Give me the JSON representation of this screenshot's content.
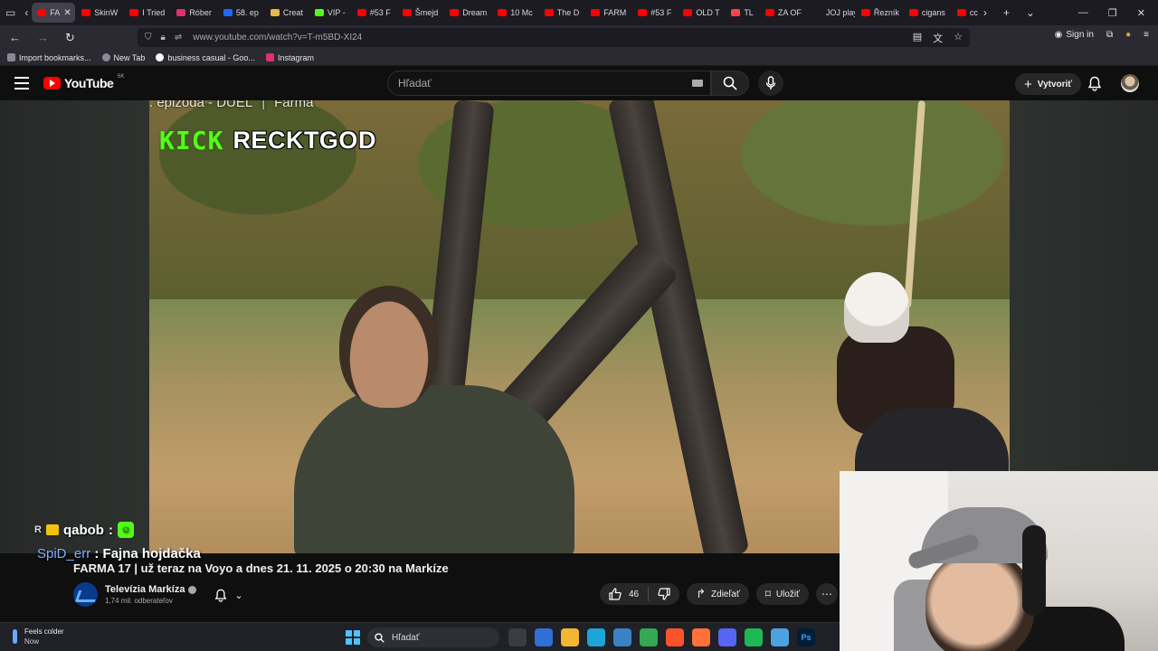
{
  "browser": {
    "tabs": [
      {
        "label": "FA",
        "active": true,
        "color": "#ff0000"
      },
      {
        "label": "SkinW",
        "color": "#ff0000"
      },
      {
        "label": "I Tried",
        "color": "#ff0000"
      },
      {
        "label": "Róber",
        "color": "#e1306c"
      },
      {
        "label": "58. ep",
        "color": "#1e6aff"
      },
      {
        "label": "Creat",
        "color": "#e8b84a"
      },
      {
        "label": "VIP -",
        "color": "#53fc18"
      },
      {
        "label": "#53 F",
        "color": "#ff0000"
      },
      {
        "label": "Šmejd",
        "color": "#ff0000"
      },
      {
        "label": "Dream",
        "color": "#ff0000"
      },
      {
        "label": "10 Mc",
        "color": "#ff0000"
      },
      {
        "label": "The D",
        "color": "#ff0000"
      },
      {
        "label": "FARM",
        "color": "#ff0000"
      },
      {
        "label": "#53 F",
        "color": "#ff0000"
      },
      {
        "label": "OLD T",
        "color": "#ff0000"
      },
      {
        "label": "TL",
        "color": "#ff4444"
      },
      {
        "label": "ZA OF",
        "color": "#ff0000"
      },
      {
        "label": "JOJ play",
        "color": "#1c1b22"
      },
      {
        "label": "Řezník",
        "color": "#ff0000"
      },
      {
        "label": "cigans",
        "color": "#ff0000"
      },
      {
        "label": "cc",
        "color": "#ff0000"
      }
    ],
    "url": "www.youtube.com/watch?v=T-m5BD-XI24",
    "sign_in": "Sign in",
    "bookmarks": [
      "Import bookmarks...",
      "New Tab",
      "business casual - Goo...",
      "Instagram"
    ]
  },
  "youtube": {
    "logo_text": "YouTube",
    "region": "SK",
    "search_placeholder": "Hľadať",
    "create_label": "Vytvoriť"
  },
  "video": {
    "overlay_title": ". epizóda - DUEL",
    "overlay_show": "Farma",
    "kick_logo": "KICK",
    "kick_channel": "RECKTGOD",
    "chat": [
      {
        "user": "qabob",
        "message": ""
      },
      {
        "user": "SpiD_err",
        "message": "Fajna hojdačka"
      }
    ],
    "title": "FARMA 17 | už teraz na Voyo a dnes 21. 11. 2025 o 20:30 na Markíze",
    "channel_name": "Televízia Markíza",
    "subscribers": "1,74 mil. odberateľov",
    "likes": "46",
    "share_label": "Zdieľať",
    "save_label": "Uložiť"
  },
  "taskbar": {
    "weather_title": "Feels colder",
    "weather_sub": "Now",
    "search_placeholder": "Hľadať",
    "apps": [
      {
        "name": "task-view",
        "color": "#3a3c42"
      },
      {
        "name": "store",
        "color": "#2f6fd6"
      },
      {
        "name": "file-explorer",
        "color": "#f2b632"
      },
      {
        "name": "edge",
        "color": "#1da4d8"
      },
      {
        "name": "photos",
        "color": "#3b82c4"
      },
      {
        "name": "chrome",
        "color": "#34a853"
      },
      {
        "name": "brave",
        "color": "#fb542b"
      },
      {
        "name": "firefox",
        "color": "#ff7139"
      },
      {
        "name": "discord",
        "color": "#5865f2"
      },
      {
        "name": "spotify",
        "color": "#1db954"
      },
      {
        "name": "notepad",
        "color": "#4aa3df"
      },
      {
        "name": "photoshop",
        "label": "Ps",
        "color": "#001e36"
      }
    ]
  }
}
